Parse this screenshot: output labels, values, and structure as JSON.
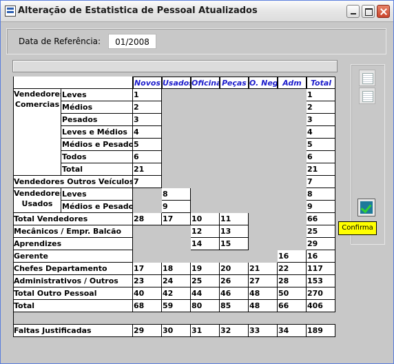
{
  "window": {
    "title": "Alteração de Estatistica de Pessoal Atualizados"
  },
  "reference": {
    "label": "Data de Referência:",
    "value": "01/2008"
  },
  "tooltip": "Confirma",
  "columns": [
    "Novos",
    "Usados",
    "Oficina",
    "Peças",
    "O. Neg.",
    "Adm",
    "Total"
  ],
  "groups": {
    "comercias": "Vendedores Comercias",
    "usados": "Vendedores Usados"
  },
  "rows": {
    "leves": {
      "label": "Leves",
      "novos": "1",
      "total": "1"
    },
    "medios": {
      "label": "Médios",
      "novos": "2",
      "total": "2"
    },
    "pesados": {
      "label": "Pesados",
      "novos": "3",
      "total": "3"
    },
    "leves_medios": {
      "label": "Leves e Médios",
      "novos": "4",
      "total": "4"
    },
    "medios_pesados": {
      "label": "Médios e Pesados",
      "novos": "5",
      "total": "5"
    },
    "todos": {
      "label": "Todos",
      "novos": "6",
      "total": "6"
    },
    "total_com": {
      "label": "Total",
      "novos": "21",
      "total": "21"
    },
    "outros_veic": {
      "label": "Vendedores Outros Veículos",
      "novos": "7",
      "total": "7"
    },
    "us_leves": {
      "label": "Leves",
      "usados": "8",
      "total": "8"
    },
    "us_medios_pesados": {
      "label": "Médios e Pesados",
      "usados": "9",
      "total": "9"
    },
    "total_vend": {
      "label": "Total Vendedores",
      "novos": "28",
      "usados": "17",
      "oficina": "10",
      "pecas": "11",
      "total": "66"
    },
    "mecanicos": {
      "label": "Mecânicos / Empr. Balcão",
      "oficina": "12",
      "pecas": "13",
      "total": "25"
    },
    "aprendizes": {
      "label": "Aprendizes",
      "oficina": "14",
      "pecas": "15",
      "total": "29"
    },
    "gerente": {
      "label": "Gerente",
      "adm": "16",
      "total": "16"
    },
    "chefes": {
      "label": "Chefes Departamento",
      "novos": "17",
      "usados": "18",
      "oficina": "19",
      "pecas": "20",
      "oneg": "21",
      "adm": "22",
      "total": "117"
    },
    "admin": {
      "label": "Administrativos / Outros",
      "novos": "23",
      "usados": "24",
      "oficina": "25",
      "pecas": "26",
      "oneg": "27",
      "adm": "28",
      "total": "153"
    },
    "outro_pessoal": {
      "label": "Total Outro Pessoal",
      "novos": "40",
      "usados": "42",
      "oficina": "44",
      "pecas": "46",
      "oneg": "48",
      "adm": "50",
      "total": "270"
    },
    "total": {
      "label": "Total",
      "novos": "68",
      "usados": "59",
      "oficina": "80",
      "pecas": "85",
      "oneg": "48",
      "adm": "66",
      "total": "406"
    },
    "faltas": {
      "label": "Faltas Justificadas",
      "novos": "29",
      "usados": "30",
      "oficina": "31",
      "pecas": "32",
      "oneg": "33",
      "adm": "34",
      "total": "189"
    }
  }
}
